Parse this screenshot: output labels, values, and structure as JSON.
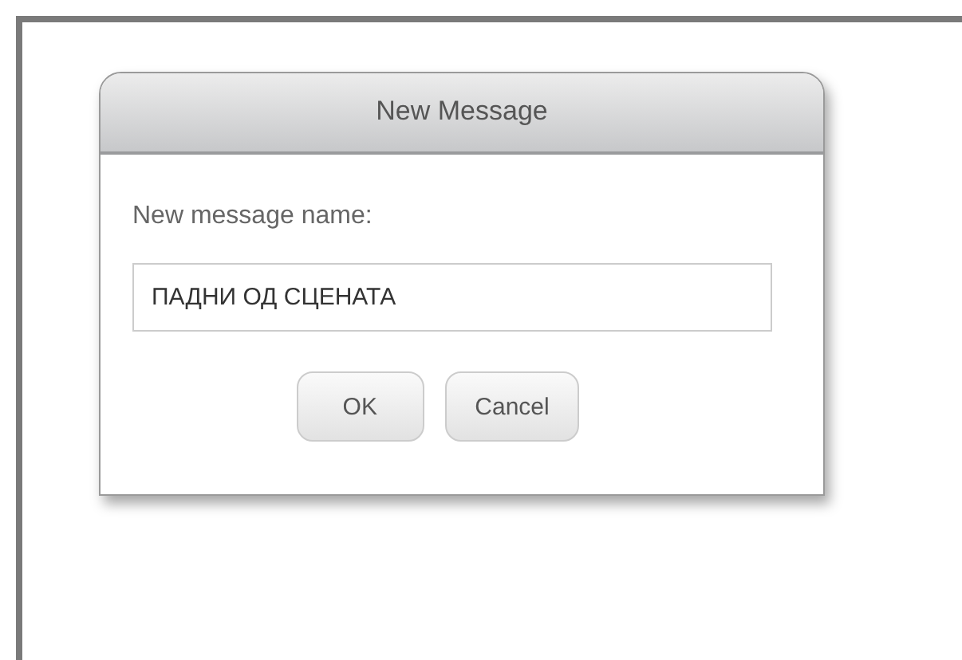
{
  "dialog": {
    "title": "New Message",
    "prompt": "New message name:",
    "field": {
      "value": "ПАДНИ ОД СЦЕНАТА"
    },
    "buttons": [
      "OK",
      "Cancel"
    ]
  }
}
